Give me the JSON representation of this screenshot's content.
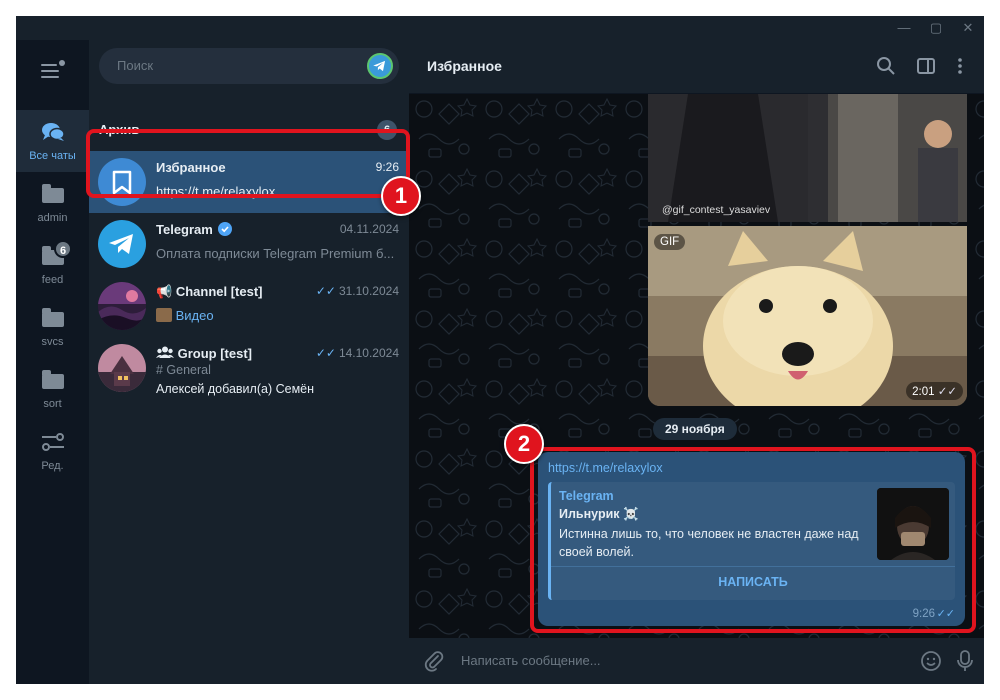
{
  "window": {
    "controls": {
      "minimize": "—",
      "maximize": "▢",
      "close": "✕"
    }
  },
  "folders": [
    {
      "label": "Все чаты",
      "icon": "chats-icon",
      "active": true,
      "badge": ""
    },
    {
      "label": "admin",
      "icon": "folder-icon",
      "active": false,
      "badge": ""
    },
    {
      "label": "feed",
      "icon": "folder-icon",
      "active": false,
      "badge": "6"
    },
    {
      "label": "svcs",
      "icon": "folder-icon",
      "active": false,
      "badge": ""
    },
    {
      "label": "sort",
      "icon": "folder-icon",
      "active": false,
      "badge": ""
    },
    {
      "label": "Ред.",
      "icon": "edit-folders-icon",
      "active": false,
      "badge": ""
    }
  ],
  "search": {
    "placeholder": "Поиск"
  },
  "archive": {
    "title": "Архив",
    "count": "6"
  },
  "chats": [
    {
      "name": "Избранное",
      "time": "9:26",
      "message": "https://t.me/relaxylox"
    },
    {
      "name": "Telegram",
      "time": "04.11.2024",
      "message": "Оплата подписки Telegram Premium б..."
    },
    {
      "name": "Channel [test]",
      "time": "31.10.2024",
      "message": "Видео"
    },
    {
      "name": "Group [test]",
      "time": "14.10.2024",
      "topic": "# General",
      "message": "Алексей добавил(а) Семён"
    }
  ],
  "chat": {
    "title": "Избранное",
    "gif_caption": "@gif_contest_yasaviev",
    "gif_label": "GIF",
    "gif_time": "2:01",
    "date": "29 ноября",
    "message": {
      "link": "https://t.me/relaxylox",
      "preview_site": "Telegram",
      "preview_title": "Ильнурик ☠️",
      "preview_text": "Истинна лишь то, что человек не властен даже над своей волей.",
      "button": "НАПИСАТЬ",
      "time": "9:26"
    },
    "composer_placeholder": "Написать сообщение..."
  },
  "annotations": {
    "marker1": "1",
    "marker2": "2"
  },
  "colors": {
    "accent": "#6ab3f3",
    "highlight": "#e0141e",
    "selected": "#2b5278"
  }
}
